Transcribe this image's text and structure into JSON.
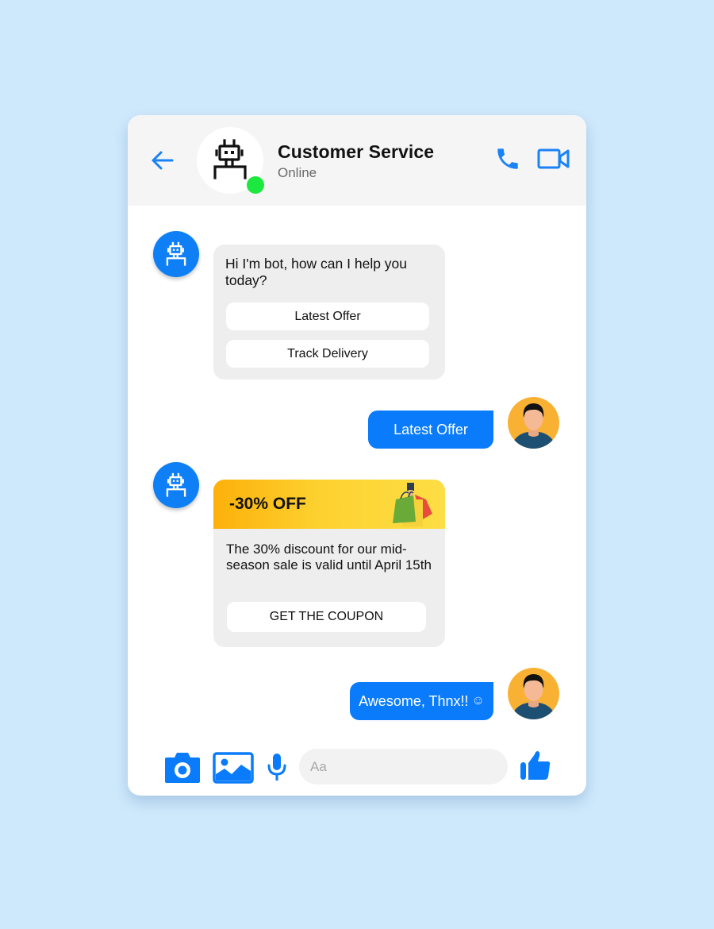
{
  "header": {
    "title": "Customer Service",
    "status": "Online",
    "icons": {
      "back": "arrow-left-icon",
      "avatar": "robot-icon",
      "presence": "online-dot",
      "call": "phone-icon",
      "video": "video-camera-icon"
    }
  },
  "messages": [
    {
      "sender": "bot",
      "text": "Hi I'm bot, how can I help you today?",
      "quick_replies": [
        "Latest Offer",
        "Track Delivery"
      ]
    },
    {
      "sender": "user",
      "text": "Latest Offer"
    },
    {
      "sender": "bot",
      "banner_title": "-30% OFF",
      "banner_icon": "shopping-bags-icon",
      "text": "The 30% discount for our mid-season sale is valid until April 15th",
      "button": "GET THE COUPON"
    },
    {
      "sender": "user",
      "text": "Awesome, Thnx!!",
      "emoji": "☺"
    }
  ],
  "composer": {
    "placeholder": "Aa",
    "value": "",
    "icons": [
      "camera-icon",
      "image-icon",
      "microphone-icon",
      "thumbs-up-icon"
    ]
  },
  "colors": {
    "accent": "#0a7cfb",
    "online": "#1de83f",
    "background": "#cfe9fc",
    "bubble_bot": "#efeeef",
    "banner_start": "#fdb00a",
    "banner_end": "#fdde45",
    "user_avatar_bg": "#f8b133"
  }
}
